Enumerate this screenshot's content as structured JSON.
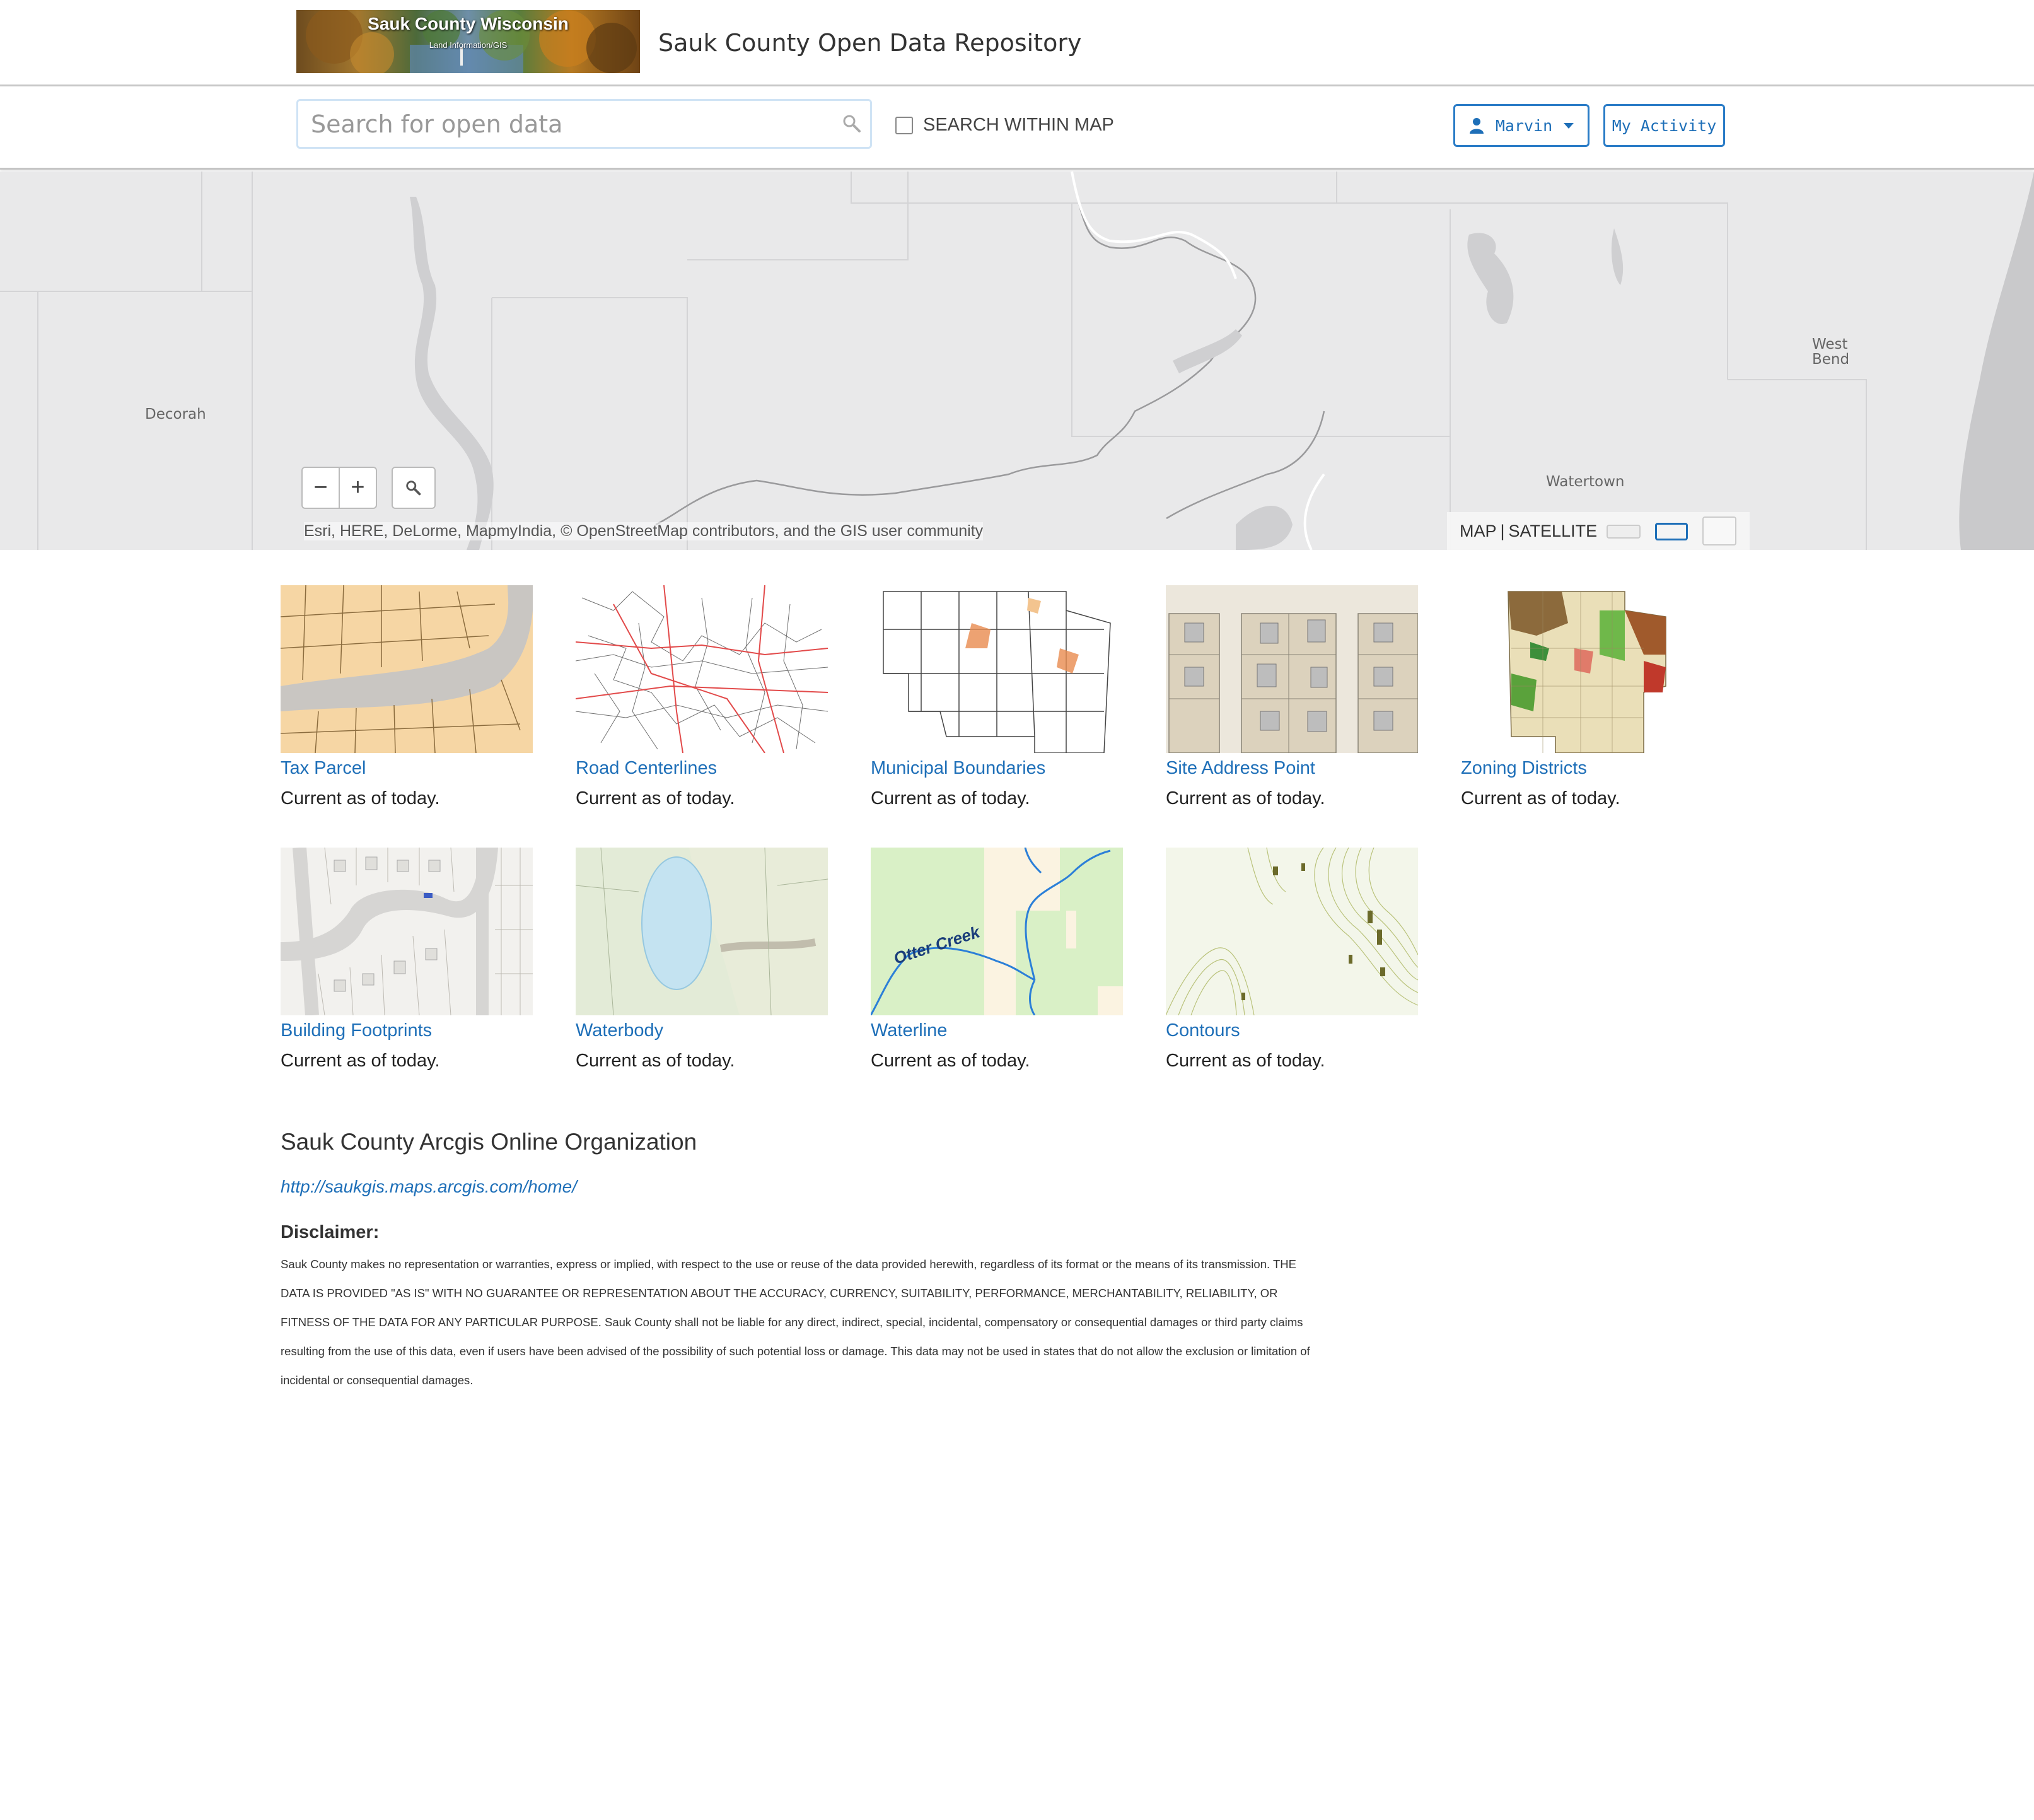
{
  "header": {
    "logo_title": "Sauk County Wisconsin",
    "logo_subtitle": "Land Information/GIS",
    "site_title": "Sauk County Open Data Repository"
  },
  "toolbar": {
    "search_placeholder": "Search for open data",
    "search_within_map_label": "SEARCH WITHIN MAP",
    "search_within_map_checked": false,
    "user_button_label": "Marvin",
    "activity_button_label": "My Activity"
  },
  "map": {
    "places": [
      "Decorah",
      "West Bend",
      "Watertown"
    ],
    "zoom_out": "−",
    "zoom_in": "+",
    "attribution": "Esri, HERE, DeLorme, MapmyIndia, © OpenStreetMap contributors, and the GIS user community",
    "basemap_map": "MAP",
    "basemap_satellite": "SATELLITE",
    "accent_color": "#1e6fb8"
  },
  "datasets": [
    {
      "title": "Tax Parcel",
      "status": "Current as of today.",
      "thumb": "tax-parcel"
    },
    {
      "title": "Road Centerlines",
      "status": "Current as of today.",
      "thumb": "road-centerlines"
    },
    {
      "title": "Municipal Boundaries",
      "status": "Current as of today.",
      "thumb": "municipal-boundaries"
    },
    {
      "title": "Site Address Point",
      "status": "Current as of today.",
      "thumb": "site-address-point"
    },
    {
      "title": "Zoning Districts",
      "status": "Current as of today.",
      "thumb": "zoning-districts"
    },
    {
      "title": "Building Footprints",
      "status": "Current as of today.",
      "thumb": "building-footprints"
    },
    {
      "title": "Waterbody",
      "status": "Current as of today.",
      "thumb": "waterbody"
    },
    {
      "title": "Waterline",
      "status": "Current as of today.",
      "thumb": "waterline",
      "label": "Otter Creek"
    },
    {
      "title": "Contours",
      "status": "Current as of today.",
      "thumb": "contours"
    }
  ],
  "org": {
    "title": "Sauk County Arcgis Online Organization",
    "link": "http://saukgis.maps.arcgis.com/home/"
  },
  "disclaimer": {
    "title": "Disclaimer:",
    "text": "Sauk County makes no representation or warranties, express or implied, with respect to the use or reuse of the data provided herewith, regardless of its format or the means of its transmission. THE DATA IS PROVIDED \"AS IS\" WITH NO GUARANTEE OR REPRESENTATION ABOUT THE ACCURACY, CURRENCY, SUITABILITY, PERFORMANCE, MERCHANTABILITY, RELIABILITY, OR FITNESS OF THE DATA FOR ANY PARTICULAR PURPOSE. Sauk County shall not be liable for any direct, indirect, special, incidental, compensatory or consequential damages or third party claims resulting from the use of this data, even if users have been advised of the possibility of such potential loss or damage. This data may not be used in states that do not allow the exclusion or limitation of incidental or consequential damages."
  }
}
